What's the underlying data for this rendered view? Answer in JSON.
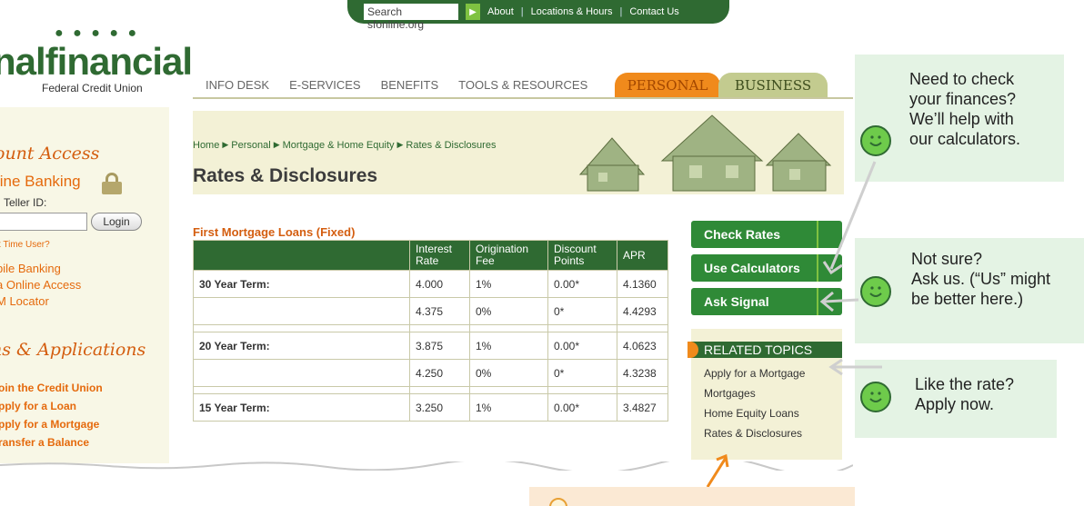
{
  "utility_bar": {
    "search_label": "Search sfonline.org",
    "links": [
      "About",
      "Locations & Hours",
      "Contact Us"
    ]
  },
  "brand": {
    "name_fragment": "nalfinancial",
    "subtitle": "Federal Credit Union"
  },
  "nav": {
    "items": [
      "INFO DESK",
      "E-SERVICES",
      "BENEFITS",
      "TOOLS & RESOURCES"
    ],
    "tab_personal": "PERSONAL",
    "tab_business": "BUSINESS"
  },
  "sidebar": {
    "account_title": "ount Access",
    "online_banking": "line Banking",
    "teller_label": "Teller ID:",
    "login_label": "Login",
    "first_time": "t Time User?",
    "links": [
      "bile Banking",
      "a Online Access",
      "M Locator"
    ],
    "apps_title": "ns & Applications",
    "app_links": [
      "oin the Credit Union",
      "pply for a Loan",
      "pply for a Mortgage",
      "ransfer a Balance"
    ]
  },
  "breadcrumb": [
    "Home",
    "Personal",
    "Mortgage & Home Equity",
    "Rates & Disclosures"
  ],
  "page_title": "Rates & Disclosures",
  "table": {
    "title": "First Mortgage Loans (Fixed)",
    "headers": [
      "",
      "Interest Rate",
      "Origination Fee",
      "Discount Points",
      "APR"
    ],
    "rows": [
      {
        "term": "30 Year Term:",
        "rate": "4.000",
        "fee": "1%",
        "points": "0.00*",
        "apr": "4.1360"
      },
      {
        "term": "",
        "rate": "4.375",
        "fee": "0%",
        "points": "0*",
        "apr": "4.4293"
      },
      {
        "term": "20 Year Term:",
        "rate": "3.875",
        "fee": "1%",
        "points": "0.00*",
        "apr": "4.0623"
      },
      {
        "term": "",
        "rate": "4.250",
        "fee": "0%",
        "points": "0*",
        "apr": "4.3238"
      },
      {
        "term": "15 Year Term:",
        "rate": "3.250",
        "fee": "1%",
        "points": "0.00*",
        "apr": "3.4827"
      }
    ]
  },
  "actions": {
    "check_rates": "Check Rates",
    "use_calculators": "Use Calculators",
    "ask_signal": "Ask Signal"
  },
  "related": {
    "title": "RELATED TOPICS",
    "links": [
      "Apply for a Mortgage",
      "Mortgages",
      "Home Equity Loans",
      "Rates & Disclosures"
    ]
  },
  "callouts": {
    "c1": [
      "Need to check",
      "your finances?",
      "We’ll help with",
      "our calculators."
    ],
    "c2": [
      "Not sure?",
      "Ask us. (“Us” might",
      "be better here.)"
    ],
    "c3": [
      "Like the rate?",
      "Apply now."
    ]
  },
  "colors": {
    "brand_green": "#2f6a32",
    "accent_orange": "#f08a1c",
    "button_green": "#2f8a37",
    "callout_bg": "#e4f3e4"
  }
}
